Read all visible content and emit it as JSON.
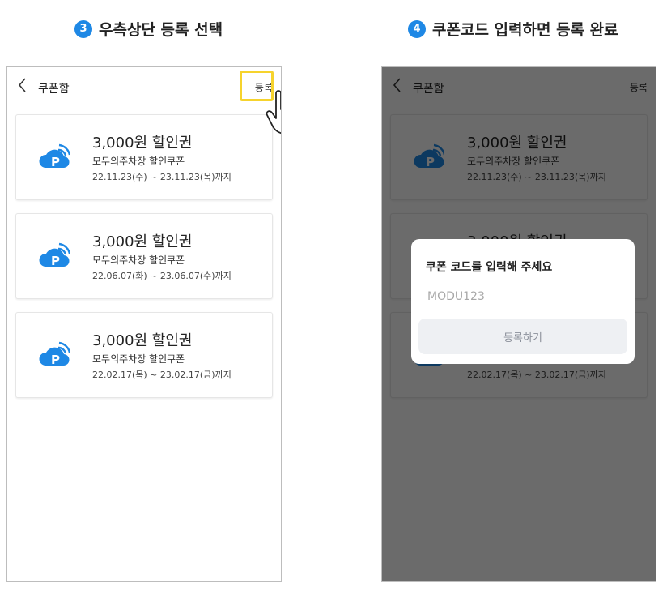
{
  "steps": [
    {
      "number": "3",
      "title": "우측상단 등록 선택"
    },
    {
      "number": "4",
      "title": "쿠폰코드 입력하면 등록 완료"
    }
  ],
  "appbar": {
    "back_icon": "chevron-left-icon",
    "title": "쿠폰함",
    "register_label": "등록"
  },
  "coupons": [
    {
      "amount": "3,000원 할인권",
      "name": "모두의주차장 할인쿠폰",
      "period": "22.11.23(수) ~ 23.11.23(목)까지"
    },
    {
      "amount": "3,000원 할인권",
      "name": "모두의주차장 할인쿠폰",
      "period": "22.06.07(화) ~ 23.06.07(수)까지"
    },
    {
      "amount": "3,000원 할인권",
      "name": "모두의주차장 할인쿠폰",
      "period": "22.02.17(목) ~ 23.02.17(금)까지"
    }
  ],
  "dialog": {
    "title": "쿠폰 코드를 입력해 주세요",
    "code_value": "MODU123",
    "submit_label": "등록하기"
  },
  "colors": {
    "accent": "#1e88e5",
    "logo": "#1e88e5",
    "highlight": "#f6d32d",
    "overlay": "rgba(0,0,0,0.58)"
  }
}
